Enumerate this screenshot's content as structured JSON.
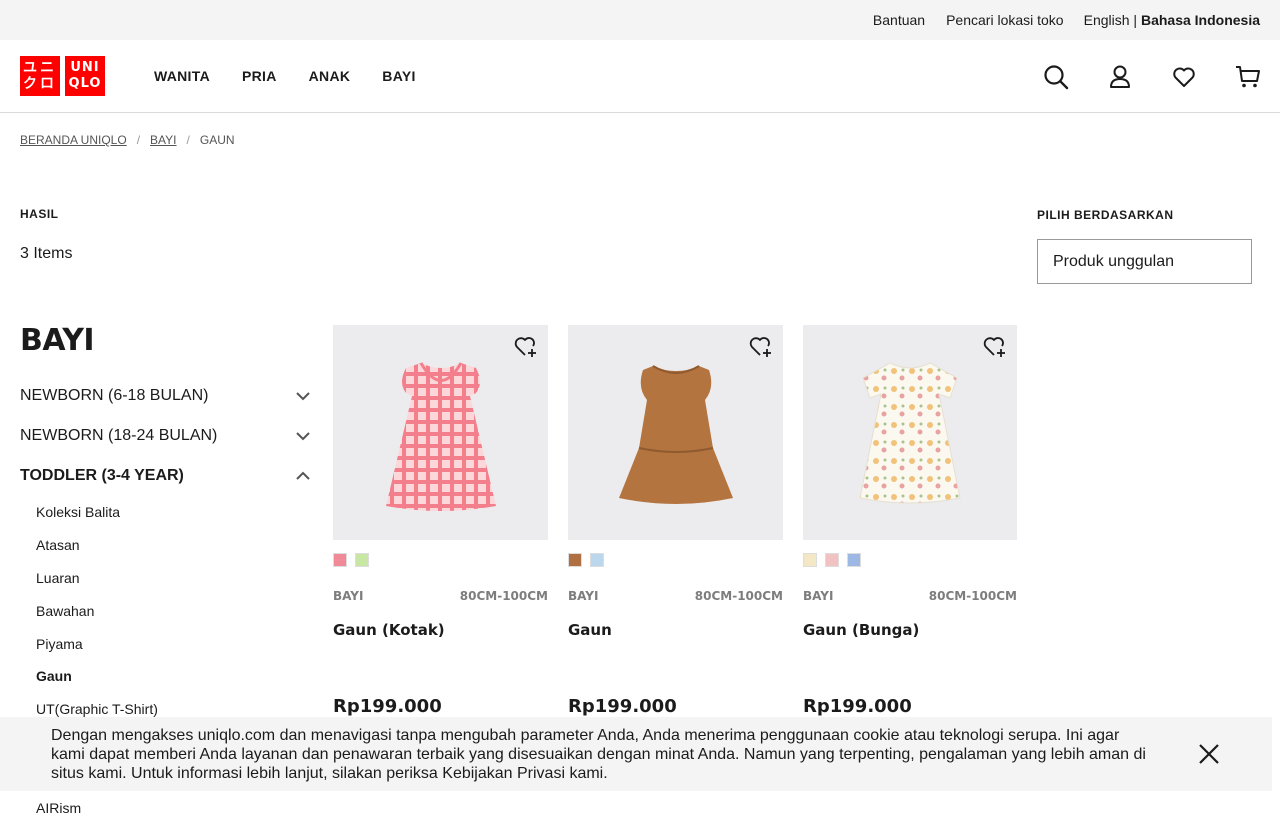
{
  "utility": {
    "help": "Bantuan",
    "store_locator": "Pencari lokasi toko",
    "lang_en": "English |",
    "lang_id": "Bahasa Indonesia"
  },
  "logo": {
    "kana_top": "ユニ",
    "kana_bottom": "クロ",
    "en_top": "UNI",
    "en_bottom": "QLO"
  },
  "nav": [
    "WANITA",
    "PRIA",
    "ANAK",
    "BAYI"
  ],
  "icons": [
    "search-icon",
    "account-icon",
    "heart-icon",
    "cart-icon"
  ],
  "breadcrumb": {
    "home": "BERANDA UNIQLO",
    "parent": "BAYI",
    "current": "GAUN",
    "sep": "/"
  },
  "results": {
    "label": "HASIL",
    "count": "3 Items"
  },
  "sort": {
    "label": "PILIH BERDASARKAN",
    "selected": "Produk unggulan"
  },
  "sidebar": {
    "title": "BAYI",
    "categories": [
      {
        "label": "NEWBORN (6-18 BULAN)",
        "expanded": false
      },
      {
        "label": "NEWBORN (18-24 BULAN)",
        "expanded": false
      },
      {
        "label": "TODDLER (3-4 YEAR)",
        "expanded": true
      }
    ],
    "sub_items": [
      "Koleksi Balita",
      "Atasan",
      "Luaran",
      "Bawahan",
      "Piyama",
      "Gaun",
      "UT(Graphic T-Shirt)"
    ],
    "active_sub": "Gaun",
    "last_item": "AIRism"
  },
  "products": [
    {
      "category": "BAYI",
      "size": "80CM-100CM",
      "name": "Gaun (Kotak)",
      "price": "Rp199.000",
      "swatches": [
        "#f08a98",
        "#c8e6a4"
      ],
      "color": "#f58a93"
    },
    {
      "category": "BAYI",
      "size": "80CM-100CM",
      "name": "Gaun",
      "price": "Rp199.000",
      "swatches": [
        "#b07042",
        "#bcd6ee"
      ],
      "color": "#b4743f"
    },
    {
      "category": "BAYI",
      "size": "80CM-100CM",
      "name": "Gaun (Bunga)",
      "price": "Rp199.000",
      "swatches": [
        "#f4e7c6",
        "#f2c2c2",
        "#9eb8e6"
      ],
      "color": "#f7f3ea"
    }
  ],
  "cookie": {
    "text": "Dengan mengakses uniqlo.com dan menavigasi tanpa mengubah parameter Anda, Anda menerima penggunaan cookie atau teknologi serupa. Ini agar kami dapat memberi Anda layanan dan penawaran terbaik yang disesuaikan dengan minat Anda. Namun yang terpenting, pengalaman yang lebih aman di situs kami. Untuk informasi lebih lanjut, silakan periksa Kebijakan Privasi kami."
  }
}
